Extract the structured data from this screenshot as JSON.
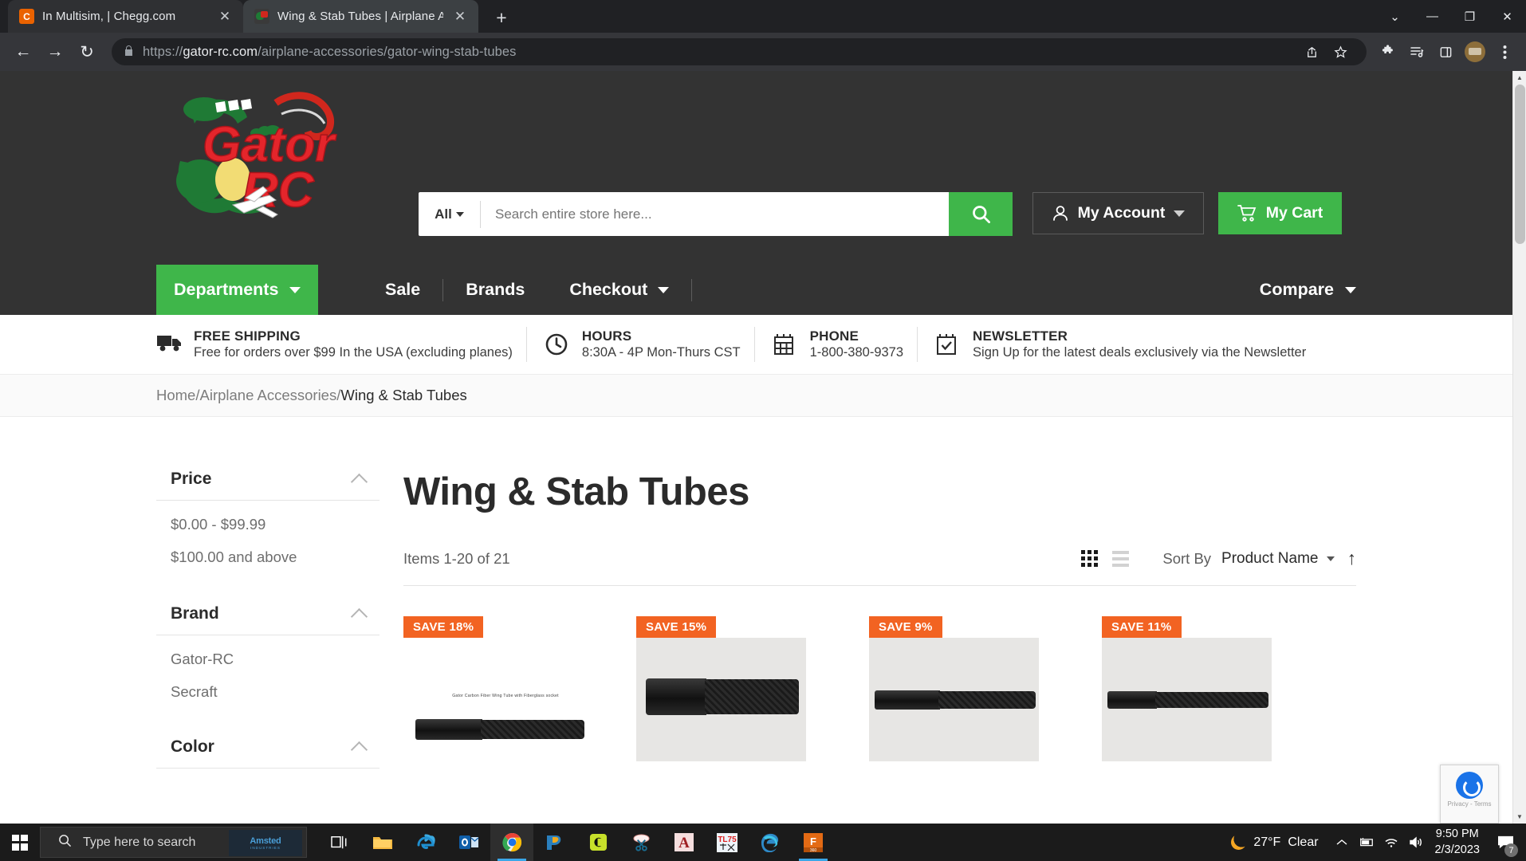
{
  "browser": {
    "tabs": [
      {
        "title": "In Multisim, | Chegg.com",
        "favicon": "chegg-icon",
        "active": false
      },
      {
        "title": "Wing & Stab Tubes | Airplane Ac",
        "favicon": "gator-icon",
        "active": true
      }
    ],
    "new_tab_label": "+",
    "window_controls": {
      "expand": "⌄",
      "minimize": "—",
      "restore": "❐",
      "close": "✕"
    },
    "nav": {
      "back": "←",
      "forward": "→",
      "reload": "↻"
    },
    "url": {
      "lock": "🔒",
      "scheme": "https://",
      "host": "gator-rc.com",
      "path": "/airplane-accessories/gator-wing-stab-tubes"
    },
    "toolbar_icons": [
      "share-icon",
      "bookmark-star-icon",
      "extensions-puzzle-icon",
      "reading-list-icon",
      "side-panel-icon",
      "profile-avatar",
      "chrome-menu-icon"
    ]
  },
  "site": {
    "logo_alt": "Gator RC",
    "search": {
      "category": "All",
      "placeholder": "Search entire store here...",
      "value": "",
      "button": "search-icon"
    },
    "account_label": "My Account",
    "cart_label": "My Cart",
    "nav": {
      "departments": "Departments",
      "links": [
        "Sale",
        "Brands",
        "Checkout"
      ],
      "compare": "Compare"
    },
    "info": [
      {
        "icon": "truck-icon",
        "title": "FREE SHIPPING",
        "text": "Free for orders over $99 In the USA (excluding planes)"
      },
      {
        "icon": "clock-icon",
        "title": "HOURS",
        "text": "8:30A - 4P Mon-Thurs CST"
      },
      {
        "icon": "calendar-icon",
        "title": "PHONE",
        "text": "1-800-380-9373"
      },
      {
        "icon": "calendar-check-icon",
        "title": "NEWSLETTER",
        "text": "Sign Up for the latest deals exclusively via the Newsletter"
      }
    ],
    "breadcrumb": {
      "home": "Home",
      "sep": "/",
      "parent": "Airplane Accessories",
      "current": "Wing & Stab Tubes"
    }
  },
  "sidebar": {
    "filters": [
      {
        "title": "Price",
        "options": [
          "$0.00 - $99.99",
          "$100.00 and above"
        ]
      },
      {
        "title": "Brand",
        "options": [
          "Gator-RC",
          "Secraft"
        ]
      },
      {
        "title": "Color",
        "options": []
      }
    ]
  },
  "main": {
    "page_title": "Wing & Stab Tubes",
    "item_count": "Items 1-20 of 21",
    "view_modes": [
      "grid-view-icon",
      "list-view-icon"
    ],
    "sort": {
      "label": "Sort By",
      "value": "Product Name",
      "direction": "↑"
    },
    "products": [
      {
        "badge": "SAVE 18%",
        "image_caption": "Gator Carbon Fiber Wing Tube with Fiberglass socket",
        "image_style": "plain"
      },
      {
        "badge": "SAVE 15%",
        "image_caption": "",
        "image_style": "photo"
      },
      {
        "badge": "SAVE 9%",
        "image_caption": "",
        "image_style": "photo"
      },
      {
        "badge": "SAVE 11%",
        "image_caption": "",
        "image_style": "photo"
      }
    ]
  },
  "recaptcha": {
    "line1": "Privacy",
    "sep": " - ",
    "line2": "Terms"
  },
  "taskbar": {
    "start": "windows-logo",
    "search_placeholder": "Type here to search",
    "search_widget": {
      "name": "Amsted",
      "sub": "INDUSTRIES"
    },
    "apps": [
      "task-view-icon",
      "file-explorer-icon",
      "internet-explorer-icon",
      "outlook-icon",
      "chrome-icon",
      "bluebeam-icon",
      "chegg-icon",
      "snipping-tool-icon",
      "autocad-icon",
      "tl75-icon",
      "edge-icon",
      "fusion360-icon"
    ],
    "weather": {
      "temp": "27°F",
      "condition": "Clear"
    },
    "tray": [
      "show-hidden-icons",
      "battery-icon",
      "wifi-icon",
      "volume-icon"
    ],
    "clock": {
      "time": "9:50 PM",
      "date": "2/3/2023"
    },
    "notifications": "7"
  },
  "colors": {
    "brand_green": "#3fb64a",
    "badge_orange": "#f26322",
    "header_dark": "#333333"
  }
}
